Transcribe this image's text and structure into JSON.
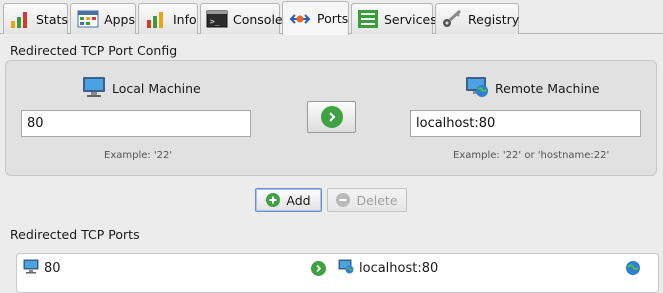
{
  "tabs": [
    {
      "label": "Stats",
      "icon": "bar-chart-icon"
    },
    {
      "label": "Apps",
      "icon": "apps-window-icon"
    },
    {
      "label": "Info",
      "icon": "info-bars-icon"
    },
    {
      "label": "Console",
      "icon": "terminal-icon"
    },
    {
      "label": "Ports",
      "icon": "ports-arrows-icon",
      "active": true
    },
    {
      "label": "Services",
      "icon": "services-list-icon"
    },
    {
      "label": "Registry",
      "icon": "registry-key-icon"
    }
  ],
  "config": {
    "title": "Redirected TCP Port Config",
    "local_label": "Local Machine",
    "local_value": "80",
    "local_hint": "Example: '22'",
    "remote_label": "Remote Machine",
    "remote_value": "localhost:80",
    "remote_hint": "Example: '22' or 'hostname:22'"
  },
  "actions": {
    "add_label": "Add",
    "delete_label": "Delete"
  },
  "ports": {
    "title": "Redirected TCP Ports",
    "rows": [
      {
        "local": "80",
        "remote": "localhost:80"
      }
    ]
  },
  "colors": {
    "green": "#3fa142",
    "accent_blue": "#6b8fc8"
  }
}
